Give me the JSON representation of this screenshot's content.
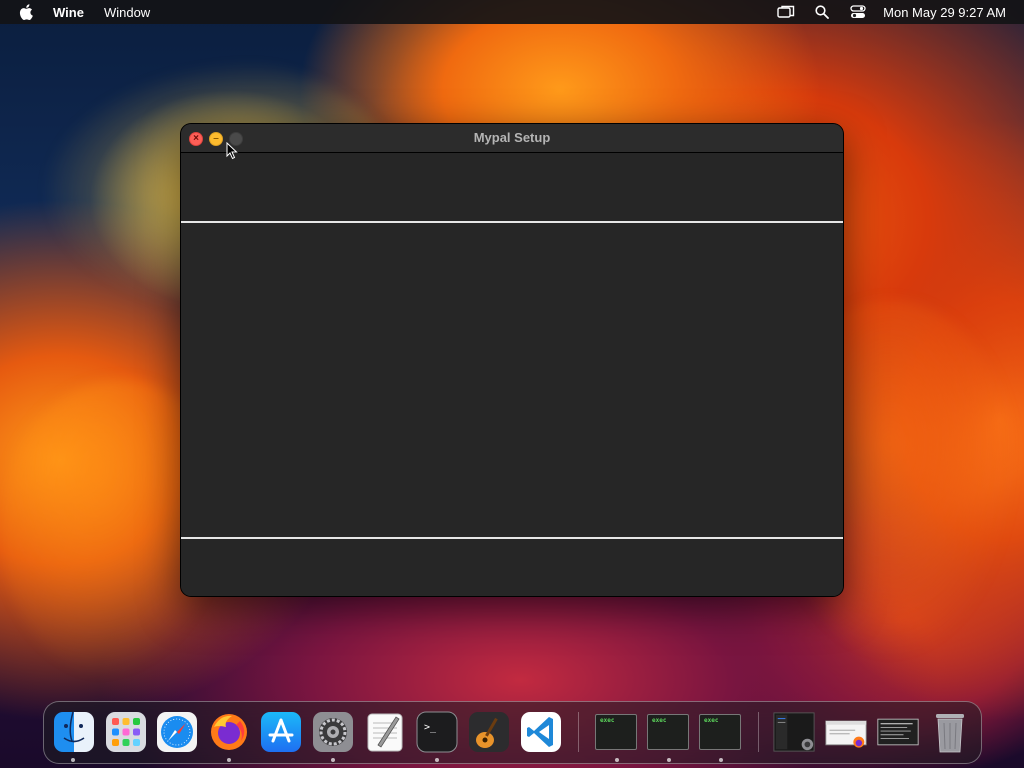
{
  "menubar": {
    "apple_icon": "apple-logo-icon",
    "app_name": "Wine",
    "menus": [
      "Window"
    ],
    "status_icons": [
      "screen-mirroring-icon",
      "search-icon",
      "control-center-icon"
    ],
    "clock": "Mon May 29  9:27 AM"
  },
  "window": {
    "title": "Mypal Setup",
    "buttons": {
      "close": "×",
      "minimize": "–"
    }
  },
  "dock": {
    "apps": [
      {
        "name": "Finder",
        "icon": "finder-icon",
        "running": true
      },
      {
        "name": "Launchpad",
        "icon": "launchpad-icon",
        "running": false
      },
      {
        "name": "Safari",
        "icon": "safari-icon",
        "running": false
      },
      {
        "name": "Firefox",
        "icon": "firefox-icon",
        "running": true
      },
      {
        "name": "App Store",
        "icon": "app-store-icon",
        "running": false
      },
      {
        "name": "System Preferences",
        "icon": "system-preferences-icon",
        "running": true
      },
      {
        "name": "TextEdit",
        "icon": "textedit-icon",
        "running": false
      },
      {
        "name": "Terminal",
        "icon": "terminal-icon",
        "running": true
      },
      {
        "name": "GarageBand",
        "icon": "garageband-icon",
        "running": false
      },
      {
        "name": "Visual Studio Code",
        "icon": "vscode-icon",
        "running": false
      }
    ],
    "exec_label": "exec",
    "windows": [
      {
        "label": "exec",
        "running": true
      },
      {
        "label": "exec",
        "running": true
      },
      {
        "label": "exec",
        "running": true
      }
    ],
    "recent": [
      "recent-window-thumbnail-1",
      "recent-window-thumbnail-2",
      "recent-window-thumbnail-3"
    ],
    "trash": "trash-icon",
    "terminal_prompt": ">_"
  }
}
